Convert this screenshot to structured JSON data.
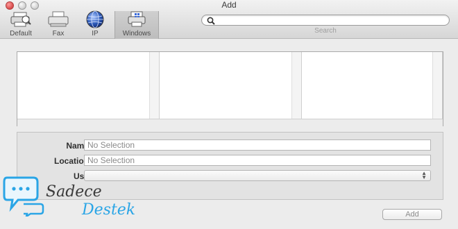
{
  "window": {
    "title": "Add"
  },
  "toolbar": {
    "tools": [
      {
        "label": "Default",
        "icon": "default-printer-icon",
        "selected": false
      },
      {
        "label": "Fax",
        "icon": "fax-icon",
        "selected": false
      },
      {
        "label": "IP",
        "icon": "globe-icon",
        "selected": false
      },
      {
        "label": "Windows",
        "icon": "windows-printer-icon",
        "selected": true
      }
    ],
    "search": {
      "value": "",
      "placeholder": "",
      "caption": "Search"
    }
  },
  "browser": {
    "columns": 3
  },
  "info": {
    "name": {
      "label": "Name:",
      "value": "No Selection"
    },
    "location": {
      "label": "Location:",
      "value": "No Selection"
    },
    "use": {
      "label": "Use:",
      "value": ""
    }
  },
  "actions": {
    "add_label": "Add"
  },
  "watermark": {
    "line1": "Sadece",
    "line2": "Destek"
  },
  "colors": {
    "close": "#d74b4b",
    "accent_logo": "#2aa5e6"
  }
}
